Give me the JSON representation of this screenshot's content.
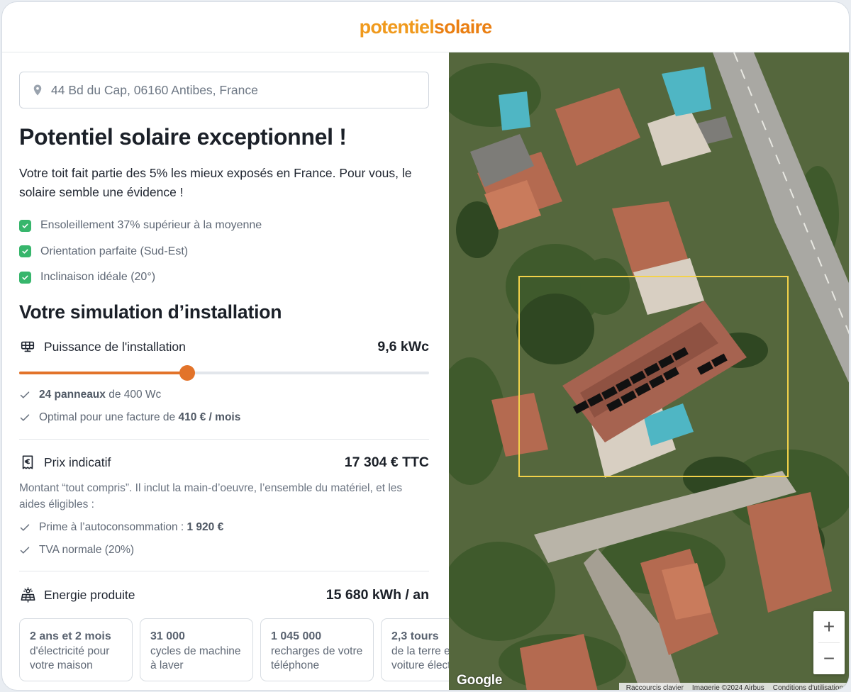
{
  "header": {
    "logo_part1": "potentiel",
    "logo_part2": "solaire"
  },
  "address": {
    "value": "44 Bd du Cap, 06160 Antibes, France"
  },
  "headline": "Potentiel solaire exceptionnel !",
  "intro": "Votre toit fait partie des 5% les mieux exposés en France. Pour vous, le solaire semble une évidence !",
  "checks": [
    "Ensoleillement 37% supérieur à la moyenne",
    "Orientation parfaite (Sud-Est)",
    "Inclinaison idéale (20°)"
  ],
  "simulation": {
    "title": "Votre simulation d’installation",
    "power": {
      "label": "Puissance de l'installation",
      "value": "9,6 kWc",
      "slider_fraction": 0.41,
      "panels_count": "24 panneaux",
      "panels_rest": " de 400 Wc",
      "bill_prefix": "Optimal pour une facture de ",
      "bill_value": "410 € / mois"
    },
    "price": {
      "label": "Prix indicatif",
      "value": "17 304 € TTC",
      "description": "Montant “tout compris”. Il inclut la main-d’oeuvre, l’ensemble du matériel, et les aides éligibles :",
      "prime_prefix": "Prime à l’autoconsommation : ",
      "prime_value": "1 920 €",
      "tva": "TVA normale (20%)"
    },
    "energy": {
      "label": "Energie produite",
      "value": "15 680 kWh / an",
      "cards": [
        {
          "value": "2 ans et 2 mois",
          "label": "d'électricité pour votre maison"
        },
        {
          "value": "31 000",
          "label": "cycles de machine à laver"
        },
        {
          "value": "1 045 000",
          "label": "recharges de votre téléphone"
        },
        {
          "value": "2,3 tours",
          "label": "de la terre en voiture électrique"
        }
      ]
    }
  },
  "map": {
    "zoom_in": "+",
    "zoom_out": "−",
    "google": "Google",
    "attribution": [
      "Raccourcis clavier",
      "Imagerie ©2024 Airbus",
      "Conditions d'utilisation"
    ]
  },
  "colors": {
    "accent": "#e2732a",
    "logo": "#f09a1d",
    "check_green": "#37b66c",
    "selection": "#f3d24a"
  }
}
